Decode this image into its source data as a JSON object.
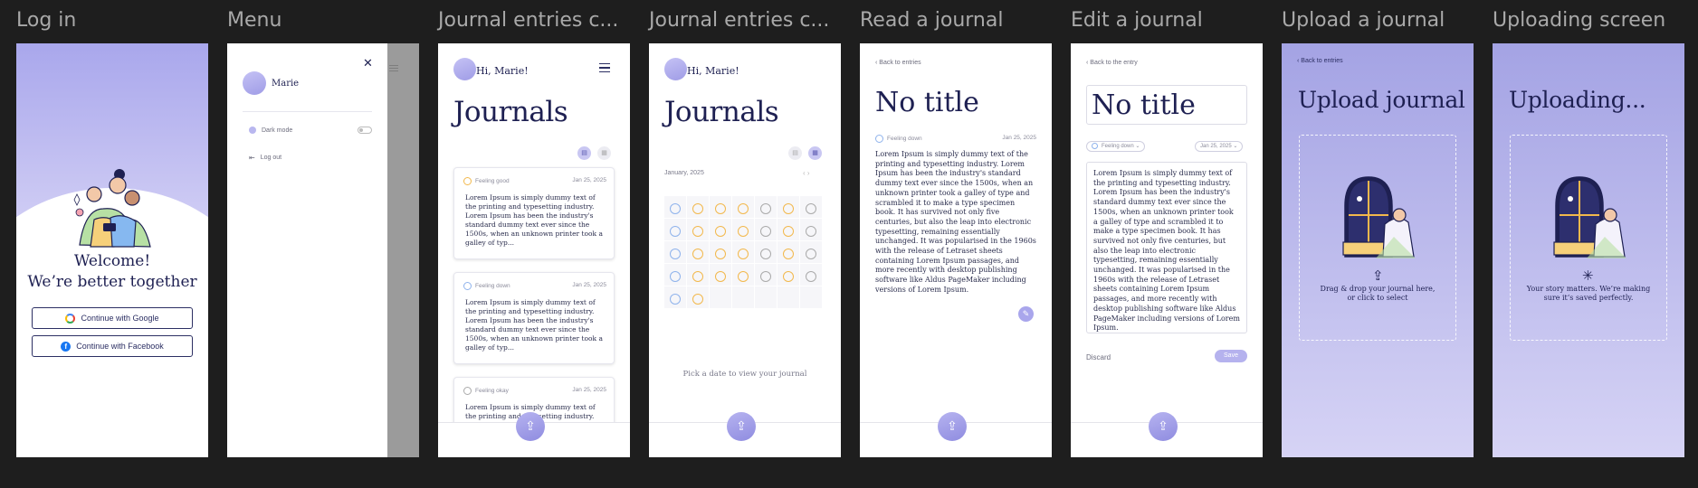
{
  "frames": {
    "login": {
      "title": "Log in",
      "welcome": "Welcome!",
      "tagline": "We’re better together",
      "google_label": "Continue with Google",
      "facebook_label": "Continue with Facebook"
    },
    "menu": {
      "title": "Menu",
      "user_name": "Marie",
      "dark_mode_label": "Dark mode",
      "logout_label": "Log out"
    },
    "journals_list": {
      "title": "Journal entries c...",
      "greeting": "Hi, Marie!",
      "page_title": "Journals",
      "entries": [
        {
          "mood": "Feeling good",
          "date": "Jan 25, 2025",
          "text": "Lorem Ipsum is simply dummy text of the printing and typesetting industry. Lorem Ipsum has been the industry's standard dummy text ever since the 1500s, when an unknown printer took a galley of typ..."
        },
        {
          "mood": "Feeling down",
          "date": "Jan 25, 2025",
          "text": "Lorem Ipsum is simply dummy text of the printing and typesetting industry. Lorem Ipsum has been the industry's standard dummy text ever since the 1500s, when an unknown printer took a galley of typ..."
        },
        {
          "mood": "Feeling okay",
          "date": "Jan 25, 2025",
          "text": "Lorem Ipsum is simply dummy text of the printing and typesetting industry. Lorem"
        }
      ]
    },
    "journals_calendar": {
      "title": "Journal entries c...",
      "greeting": "Hi, Marie!",
      "page_title": "Journals",
      "month": "January, 2025",
      "hint": "Pick a date to view your journal"
    },
    "read": {
      "title": "Read a journal",
      "back": "Back to entries",
      "journal_title": "No title",
      "mood": "Feeling down",
      "date": "Jan 25, 2025",
      "body": "Lorem Ipsum is simply dummy text of the printing and typesetting industry. Lorem Ipsum has been the industry's standard dummy text ever since the 1500s, when an unknown printer took a galley of type and scrambled it to make a type specimen book. It has survived not only five centuries, but also the leap into electronic typesetting, remaining essentially unchanged. It was popularised in the 1960s with the release of Letraset sheets containing Lorem Ipsum passages, and more recently with desktop publishing software like Aldus PageMaker including versions of Lorem Ipsum."
    },
    "edit": {
      "title": "Edit a journal",
      "back": "Back to the entry",
      "journal_title": "No title",
      "mood": "Feeling down",
      "date": "Jan 25, 2025",
      "body": "Lorem Ipsum is simply dummy text of the printing and typesetting industry. Lorem Ipsum has been the industry's standard dummy text ever since the 1500s, when an unknown printer took a galley of type and scrambled it to make a type specimen book. It has survived not only five centuries, but also the leap into electronic typesetting, remaining essentially unchanged. It was popularised in the 1960s with the release of Letraset sheets containing Lorem Ipsum passages, and more recently with desktop publishing software like Aldus PageMaker including versions of Lorem Ipsum.",
      "discard": "Discard",
      "save": "Save"
    },
    "upload": {
      "title": "Upload a journal",
      "back": "Back to entries",
      "heading": "Upload journal",
      "line1": "Drag & drop your journal here,",
      "line2": "or click to select"
    },
    "uploading": {
      "title": "Uploading screen",
      "heading": "Uploading...",
      "line1": "Your story matters. We’re making",
      "line2": "sure it’s saved perfectly."
    }
  },
  "colors": {
    "accent": "#a9a7ec",
    "ink": "#1e2052",
    "canvas": "#1e1e1e"
  }
}
